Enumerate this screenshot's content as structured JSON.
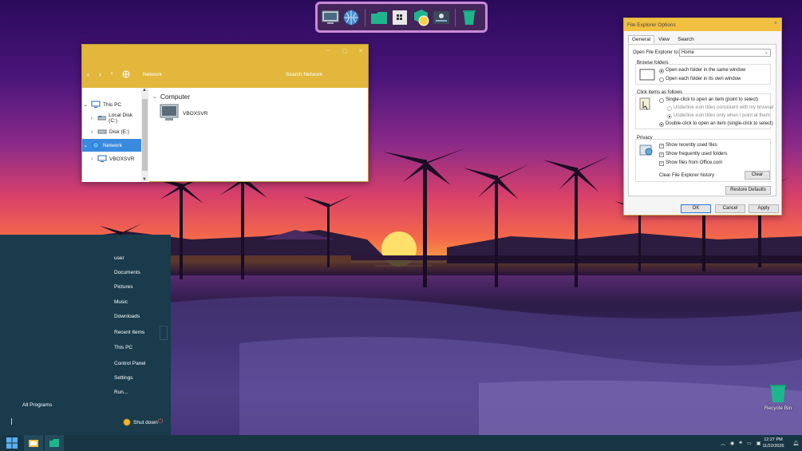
{
  "explorer": {
    "title_path": "Network",
    "search_placeholder": "Search Network",
    "tree": [
      {
        "label": "This PC"
      },
      {
        "label": "Local Disk (C:)"
      },
      {
        "label": "Disk (E:)"
      },
      {
        "label": "Network"
      },
      {
        "label": "VBOXSVR"
      }
    ],
    "group": "Computer",
    "items": [
      {
        "label": "VBOXSVR"
      }
    ]
  },
  "options": {
    "title": "File Explorer Options",
    "close_glyph": "×",
    "tabs": [
      "General",
      "View",
      "Search"
    ],
    "open_to_label": "Open File Explorer to:",
    "open_to_value": "Home",
    "browse_folders": {
      "title": "Browse folders",
      "same_window": "Open each folder in the same window",
      "own_window": "Open each folder in its own window"
    },
    "click_items": {
      "title": "Click items as follows",
      "single_click": "Single-click to open an item (point to select)",
      "underline_browser": "Underline icon titles consistent with my browser",
      "underline_point": "Underline icon titles only when I point at them",
      "double_click": "Double-click to open an item (single-click to select)"
    },
    "privacy": {
      "title": "Privacy",
      "recent_files": "Show recently used files",
      "frequent_folders": "Show frequently used folders",
      "office_files": "Show files from Office.com",
      "clear_history": "Clear File Explorer history",
      "clear_button": "Clear"
    },
    "restore_defaults": "Restore Defaults",
    "ok": "OK",
    "cancel": "Cancel",
    "apply": "Apply"
  },
  "start_menu": {
    "right_items": [
      "user",
      "Documents",
      "Pictures",
      "Music",
      "Downloads",
      "Recent Items",
      "This PC",
      "Control Panel",
      "Settings",
      "Run..."
    ],
    "all_programs": "All Programs",
    "shut_down": "Shut down"
  },
  "desktop": {
    "recycle_bin": "Recycle Bin"
  },
  "taskbar": {
    "time": "12:27 PM",
    "date": "11/22/2025"
  },
  "colors": {
    "explorer_title": "#e2b73b",
    "dialog_title": "#f1c040",
    "start_menu_bg": "#1a3b4c",
    "taskbar_bg": "#183544",
    "accent_teal": "#1fb58c",
    "selection_blue": "#3a8ae0"
  }
}
